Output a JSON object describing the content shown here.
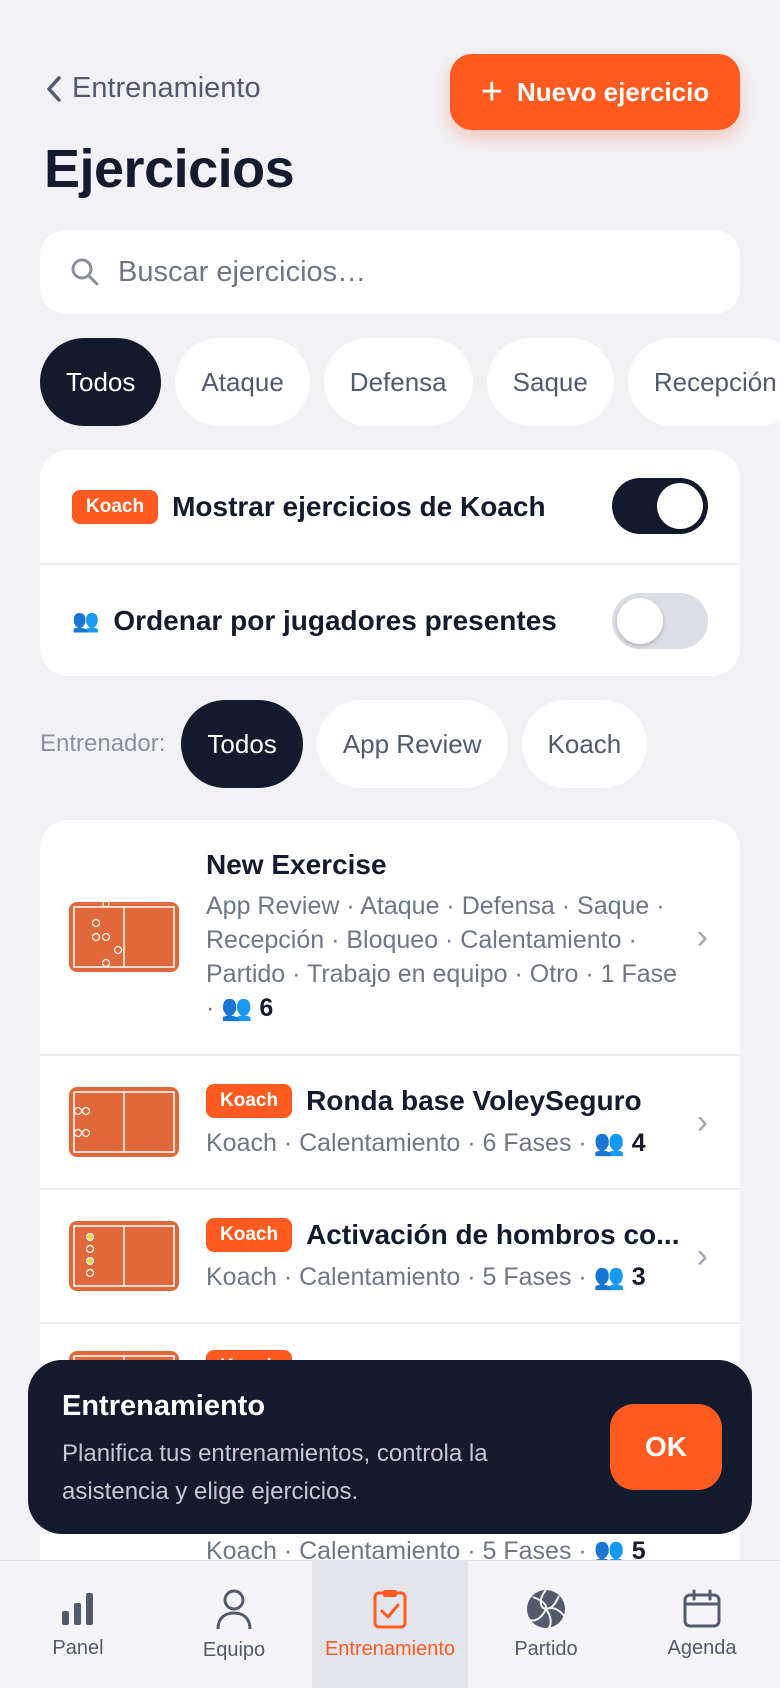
{
  "header": {
    "back_label": "Entrenamiento",
    "new_button": "Nuevo ejercicio",
    "title": "Ejercicios"
  },
  "search": {
    "placeholder": "Buscar ejercicios…"
  },
  "categories": [
    "Todos",
    "Ataque",
    "Defensa",
    "Saque",
    "Recepción"
  ],
  "toggles": {
    "koach_badge": "Koach",
    "show_koach": "Mostrar ejercicios de Koach",
    "show_koach_on": true,
    "sort_by_players": "Ordenar por jugadores presentes",
    "sort_by_players_on": false
  },
  "trainer": {
    "label": "Entrenador:",
    "options": [
      "Todos",
      "App Review",
      "Koach"
    ]
  },
  "exercises": [
    {
      "name": "New Exercise",
      "meta": "App Review · Ataque · Defensa · Saque · Recepción · Bloqueo · Calentamiento · Partido · Trabajo en equipo · Otro · 1 Fase ·",
      "players": "6"
    },
    {
      "badge": "Koach",
      "name": "Ronda base VoleySeguro",
      "meta": "Koach · Calentamiento · 6 Fases ·",
      "players": "4"
    },
    {
      "badge": "Koach",
      "name": "Activación de hombros co...",
      "meta": "Koach · Calentamiento · 5 Fases ·",
      "players": "3"
    },
    {
      "badge": "Koach",
      "name": "",
      "meta": "Koach · Calentamiento · 5 Fases ·",
      "players": "5"
    }
  ],
  "toast": {
    "title": "Entrenamiento",
    "body": "Planifica tus entrenamientos, controla la asistencia y elige ejercicios.",
    "ok": "OK"
  },
  "tabs": [
    "Panel",
    "Equipo",
    "Entrenamiento",
    "Partido",
    "Agenda"
  ],
  "colors": {
    "accent": "#ff5a1f",
    "dark": "#131a2d",
    "court": "#e0683a"
  }
}
